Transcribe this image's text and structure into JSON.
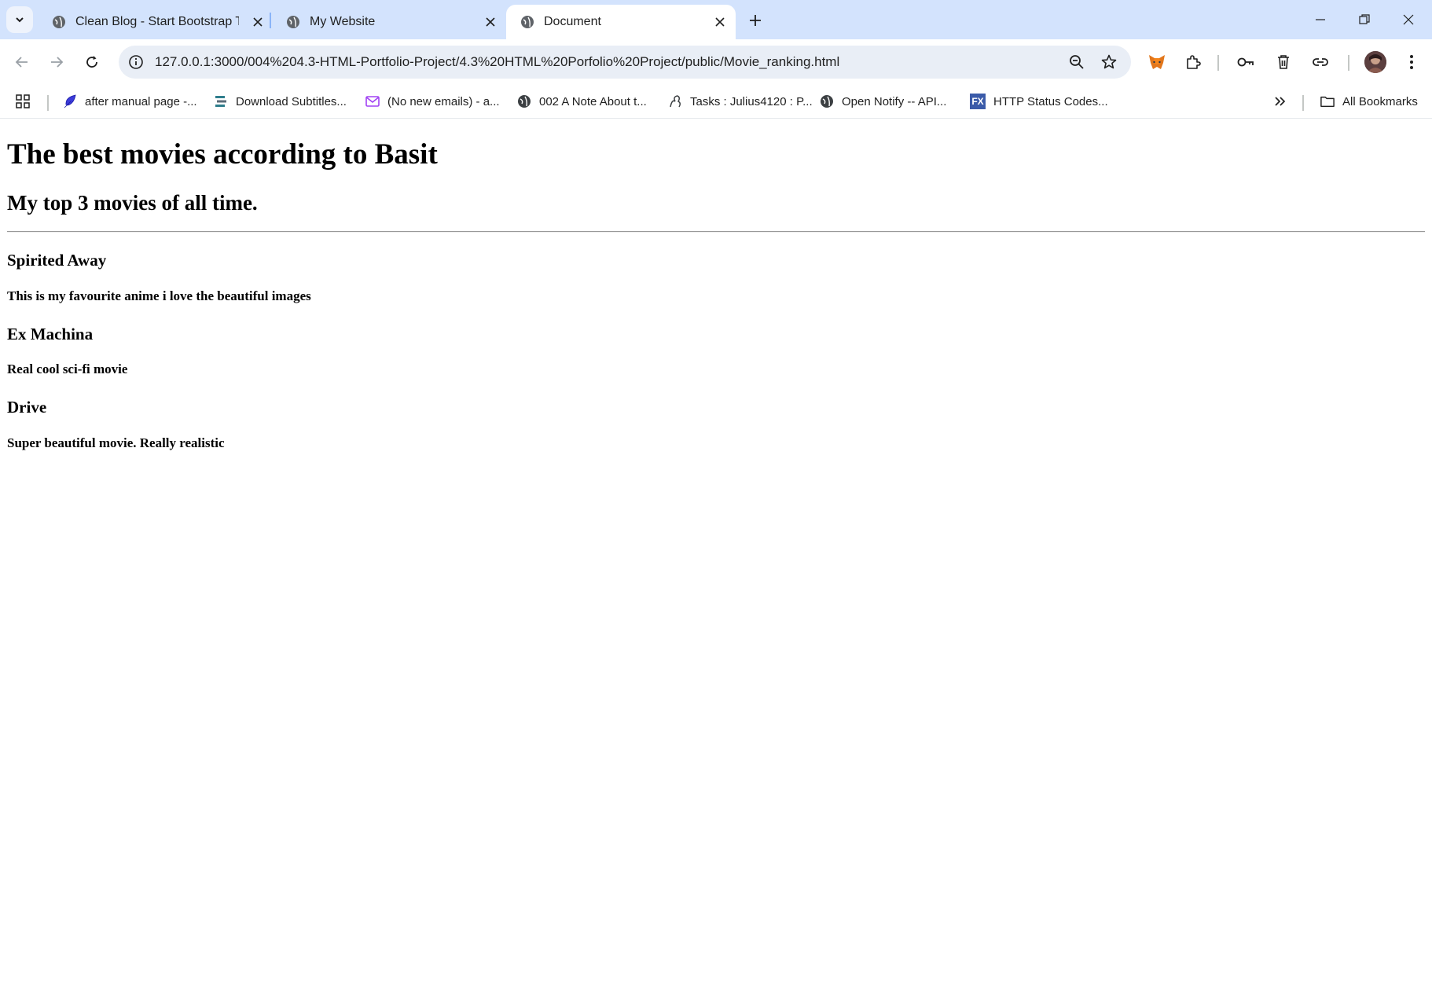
{
  "browser": {
    "tabs": [
      {
        "title": "Clean Blog - Start Bootstrap The",
        "active": false
      },
      {
        "title": "My Website",
        "active": false
      },
      {
        "title": "Document",
        "active": true
      }
    ],
    "url": "127.0.0.1:3000/004%204.3-HTML-Portfolio-Project/4.3%20HTML%20Porfolio%20Project/public/Movie_ranking.html",
    "bookmarks": [
      {
        "label": "after manual page -...",
        "icon": "feather-icon"
      },
      {
        "label": "Download Subtitles...",
        "icon": "subtitles-icon"
      },
      {
        "label": "(No new emails) - a...",
        "icon": "mail-icon"
      },
      {
        "label": "002 A Note About t...",
        "icon": "globe-icon"
      },
      {
        "label": "Tasks : Julius4120 : P...",
        "icon": "tasks-icon"
      },
      {
        "label": "Open Notify -- API...",
        "icon": "globe-icon"
      },
      {
        "label": "HTTP Status Codes...",
        "icon": "fx-icon"
      }
    ],
    "all_bookmarks_label": "All Bookmarks",
    "fx_label": "FX",
    "colors": {
      "tabstrip": "#d3e3fd",
      "omnibox": "#e9eef6"
    }
  },
  "page": {
    "title": "The best movies according to Basit",
    "subtitle": "My top 3 movies of all time.",
    "movies": [
      {
        "name": "Spirited Away",
        "description": "This is my favourite anime i love the beautiful images"
      },
      {
        "name": "Ex Machina",
        "description": "Real cool sci-fi movie"
      },
      {
        "name": "Drive",
        "description": "Super beautiful movie. Really realistic"
      }
    ]
  }
}
